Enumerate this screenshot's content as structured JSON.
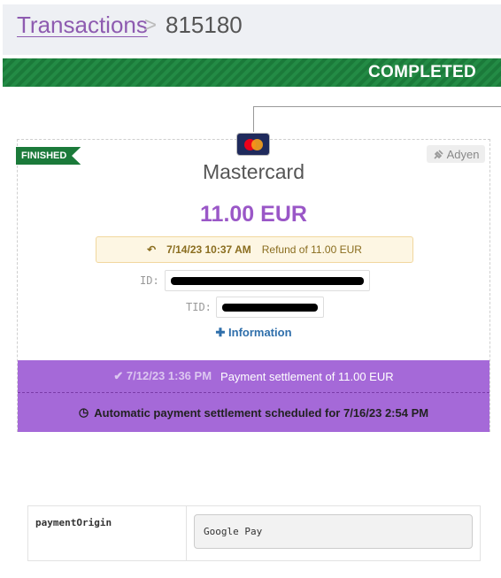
{
  "breadcrumb": {
    "parent": "Transactions",
    "separator": ">",
    "current": "815180"
  },
  "status": {
    "label": "COMPLETED",
    "color": "#238b45"
  },
  "card": {
    "badge": "FINISHED",
    "logo_icon": "mastercard-logo-icon",
    "provider": "Adyen",
    "provider_icon": "plug-icon",
    "name": "Mastercard",
    "amount": "11.00 EUR",
    "refund": {
      "icon": "reply-arrow-icon",
      "date": "7/14/23 10:37 AM",
      "text": "Refund of 11.00 EUR"
    },
    "id_label": "ID:",
    "tid_label": "TID:",
    "info_link": "Information",
    "settlement": {
      "icon": "check-icon",
      "date": "7/12/23 1:36 PM",
      "text": "Payment settlement of  11.00 EUR"
    },
    "scheduled": {
      "icon": "clock-icon",
      "text": "Automatic payment settlement scheduled for 7/16/23 2:54 PM"
    }
  },
  "metadata": [
    {
      "key": "paymentOrigin",
      "value": "Google Pay"
    }
  ],
  "colors": {
    "accent": "#9a57c7",
    "settlement_bg": "#a569d8",
    "ribbon": "#1b7a3a"
  }
}
